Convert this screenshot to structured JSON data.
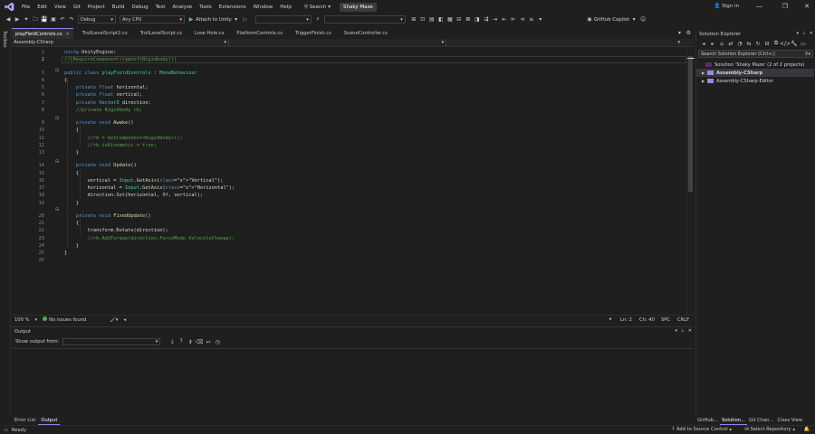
{
  "menu": [
    "File",
    "Edit",
    "View",
    "Git",
    "Project",
    "Build",
    "Debug",
    "Test",
    "Analyze",
    "Tools",
    "Extensions",
    "Window",
    "Help"
  ],
  "search_label": "Search",
  "solution_name": "Shaky Maze",
  "sign_in": "Sign in",
  "toolbar": {
    "config": "Debug",
    "platform": "Any CPU",
    "attach_label": "Attach to Unity",
    "copilot": "GitHub Copilot"
  },
  "toolbox_label": "Toolbox",
  "tabs": [
    {
      "label": "playFieldControls.cs",
      "active": true
    },
    {
      "label": "TrollLevelScript2.cs",
      "active": false
    },
    {
      "label": "TrollLevelScript.cs",
      "active": false
    },
    {
      "label": "Lose Hole.cs",
      "active": false
    },
    {
      "label": "PlatformControls.cs",
      "active": false
    },
    {
      "label": "TriggerFinish.cs",
      "active": false
    },
    {
      "label": "SceneController.cs",
      "active": false
    }
  ],
  "nav_scope": "Assembly-CSharp",
  "code_lines": [
    {
      "n": "1",
      "text": "using UnityEngine;"
    },
    {
      "n": "2",
      "text": "//[RequireComponent(typeof(Rigidbody))]"
    },
    {
      "n": "3",
      "text": "public class playFieldControls : MonoBehaviour"
    },
    {
      "n": "4",
      "text": "{"
    },
    {
      "n": "5",
      "text": "    private float horizontal;"
    },
    {
      "n": "6",
      "text": "    private float vertical;"
    },
    {
      "n": "7",
      "text": "    private Vector3 direction;"
    },
    {
      "n": "8",
      "text": "    //private Rigidbody rb;"
    },
    {
      "n": "9",
      "text": "    private void Awake()"
    },
    {
      "n": "10",
      "text": "    {"
    },
    {
      "n": "11",
      "text": "        //rb = GetComponent<Rigidbody>();"
    },
    {
      "n": "12",
      "text": "        //rb.isKinematic = true;"
    },
    {
      "n": "13",
      "text": "    }"
    },
    {
      "n": "14",
      "text": "    private void Update()"
    },
    {
      "n": "15",
      "text": "    {"
    },
    {
      "n": "16",
      "text": "        vertical = Input.GetAxis(\"Vertical\");"
    },
    {
      "n": "17",
      "text": "        horizontal = Input.GetAxis(\"Horizontal\");"
    },
    {
      "n": "18",
      "text": "        direction.Set(horizontal, 0f, vertical);"
    },
    {
      "n": "19",
      "text": "    }"
    },
    {
      "n": "20",
      "text": "    private void FixedUpdate()"
    },
    {
      "n": "21",
      "text": "    {"
    },
    {
      "n": "22",
      "text": "        transform.Rotate(direction);"
    },
    {
      "n": "23",
      "text": "        //rb.AddTorque(direction,ForceMode.VelocityChange);"
    },
    {
      "n": "24",
      "text": "    }"
    },
    {
      "n": "25",
      "text": "}"
    },
    {
      "n": "26",
      "text": ""
    }
  ],
  "editor_status": {
    "zoom": "100 %",
    "issues": "No issues found",
    "ln": "Ln: 2",
    "ch": "Ch: 40",
    "spc": "SPC",
    "crlf": "CRLF"
  },
  "output": {
    "title": "Output",
    "show_from": "Show output from:"
  },
  "bottom_tabs": [
    "Error List",
    "Output"
  ],
  "solution_explorer": {
    "title": "Solution Explorer",
    "search_placeholder": "Search Solution Explorer (Ctrl+;)",
    "tree": [
      {
        "label": "Solution 'Shaky Maze' (2 of 2 projects)",
        "level": 0
      },
      {
        "label": "Assembly-CSharp",
        "level": 1
      },
      {
        "label": "Assembly-CSharp-Editor",
        "level": 1
      }
    ],
    "bottom_tabs": [
      "GitHub...",
      "Solution...",
      "Git Chan...",
      "Class View"
    ]
  },
  "status": {
    "ready": "Ready",
    "add_source": "Add to Source Control",
    "select_repo": "Select Repository"
  },
  "colors": {
    "accent": "#9184ee",
    "keyword": "#569cd6",
    "type": "#4ec9b0",
    "comment": "#57a64a",
    "string": "#d69d85",
    "ok": "#4caf50"
  }
}
